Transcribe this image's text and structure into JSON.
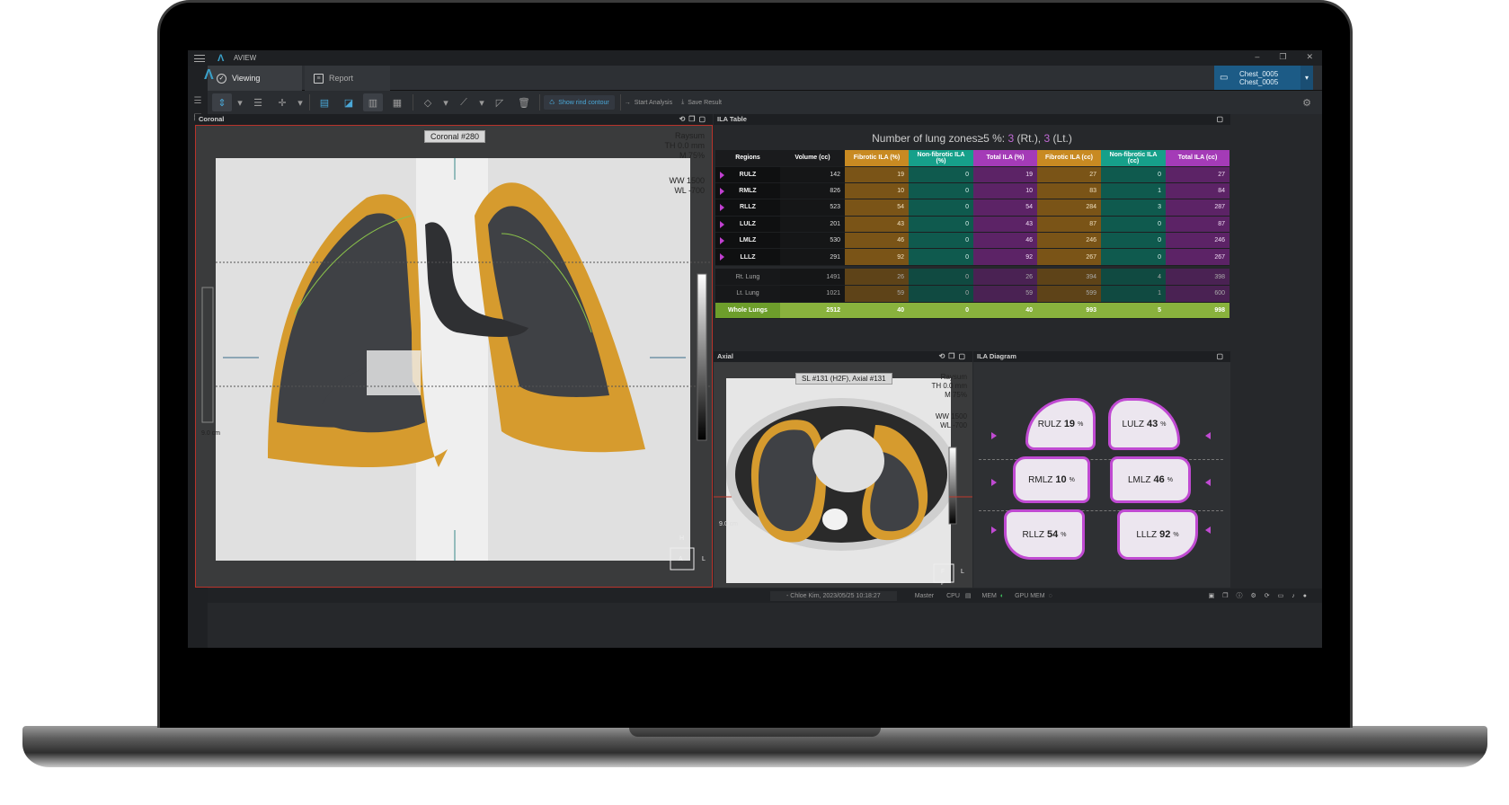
{
  "app": {
    "title": "AVIEW",
    "brand_color": "#3aa0c8"
  },
  "tabs": [
    {
      "label": "Viewing"
    },
    {
      "label": "Report"
    }
  ],
  "patient": {
    "line1": "Chest_0005",
    "line2": "Chest_0005"
  },
  "toolbar": {
    "show_rind_contour": "Show rind contour",
    "start_analysis": "Start Analysis",
    "save_result": "Save Result"
  },
  "panels": {
    "coronal": "Coronal",
    "ila_table": "ILA Table",
    "axial": "Axial",
    "ila_diagram": "ILA Diagram"
  },
  "coronal_view": {
    "label": "Coronal #280",
    "info": [
      "Raysum",
      "TH 0.0 mm",
      "M 75%"
    ],
    "window": [
      "WW  1500",
      "WL   -700"
    ],
    "scale": "9.0 cm",
    "orient": {
      "top": "H",
      "center": "A",
      "right": "L"
    }
  },
  "axial_view": {
    "label": "SL #131 (H2F), Axial #131",
    "info": [
      "Raysum",
      "TH 0.0 mm",
      "M 75%"
    ],
    "window": [
      "WW  1500",
      "WL   -700"
    ],
    "scale": "9.0 cm",
    "orient": {
      "center": "F",
      "right": "L",
      "bottom": "P"
    }
  },
  "ila": {
    "title_prefix": "Number of lung zones≥5 %:",
    "rt_value": "3",
    "rt_label": "(Rt.),",
    "lt_value": "3",
    "lt_label": "(Lt.)",
    "headers": [
      "Regions",
      "Volume (cc)",
      "Fibrotic ILA (%)",
      "Non-fibrotic ILA (%)",
      "Total ILA (%)",
      "Fibrotic ILA (cc)",
      "Non-fibrotic ILA (cc)",
      "Total ILA (cc)"
    ],
    "rows": [
      [
        "RULZ",
        "142",
        "19",
        "0",
        "19",
        "27",
        "0",
        "27"
      ],
      [
        "RMLZ",
        "826",
        "10",
        "0",
        "10",
        "83",
        "1",
        "84"
      ],
      [
        "RLLZ",
        "523",
        "54",
        "0",
        "54",
        "284",
        "3",
        "287"
      ],
      [
        "LULZ",
        "201",
        "43",
        "0",
        "43",
        "87",
        "0",
        "87"
      ],
      [
        "LMLZ",
        "530",
        "46",
        "0",
        "46",
        "246",
        "0",
        "246"
      ],
      [
        "LLLZ",
        "291",
        "92",
        "0",
        "92",
        "267",
        "0",
        "267"
      ]
    ],
    "summary": [
      [
        "Rt. Lung",
        "1491",
        "26",
        "0",
        "26",
        "394",
        "4",
        "398"
      ],
      [
        "Lt. Lung",
        "1021",
        "59",
        "0",
        "59",
        "599",
        "1",
        "600"
      ]
    ],
    "whole": [
      "Whole Lungs",
      "2512",
      "40",
      "0",
      "40",
      "993",
      "5",
      "998"
    ],
    "colors": {
      "fibrotic": "#c88a22",
      "non_fibrotic": "#16a08a",
      "total": "#a43bb7",
      "whole": "#89b23d"
    }
  },
  "diagram": {
    "lobes": [
      {
        "name": "RULZ",
        "value": "19",
        "unit": "%"
      },
      {
        "name": "LULZ",
        "value": "43",
        "unit": "%"
      },
      {
        "name": "RMLZ",
        "value": "10",
        "unit": "%"
      },
      {
        "name": "LMLZ",
        "value": "46",
        "unit": "%"
      },
      {
        "name": "RLLZ",
        "value": "54",
        "unit": "%"
      },
      {
        "name": "LLLZ",
        "value": "92",
        "unit": "%"
      }
    ]
  },
  "status": {
    "user": "-     Chloe Kim, 2023/05/25 10:18:27",
    "master": "Master",
    "cpu": "CPU",
    "mem": "MEM",
    "gpu_mem": "GPU MEM"
  }
}
